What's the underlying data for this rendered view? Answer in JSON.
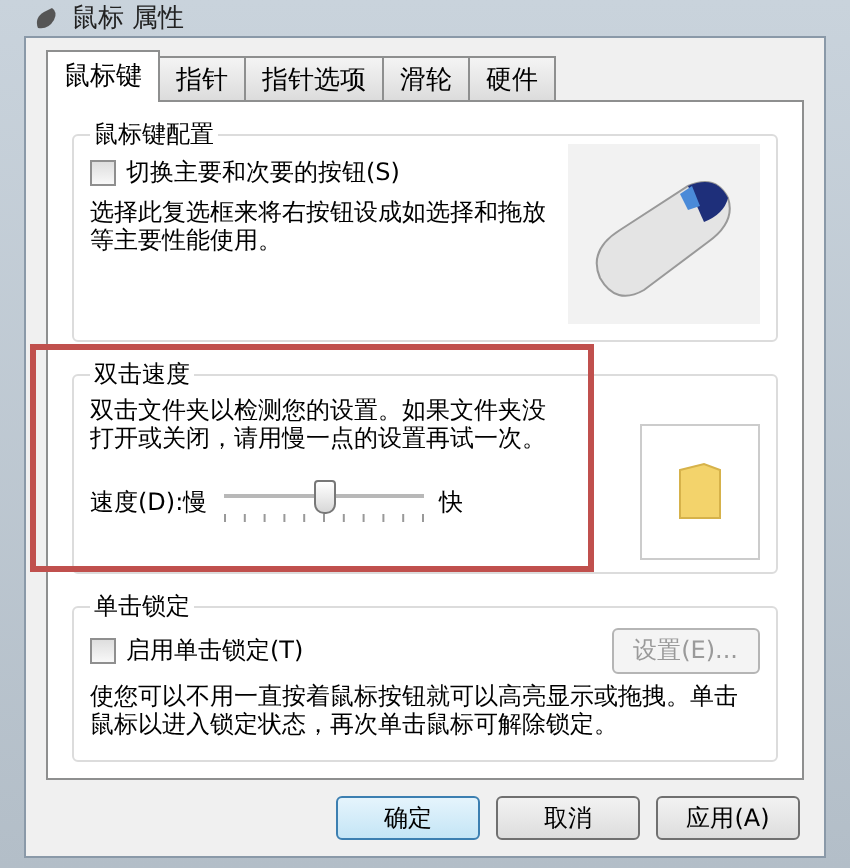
{
  "window": {
    "title": "鼠标 属性"
  },
  "tabs": [
    {
      "label": "鼠标键",
      "selected": true
    },
    {
      "label": "指针",
      "selected": false
    },
    {
      "label": "指针选项",
      "selected": false
    },
    {
      "label": "滑轮",
      "selected": false
    },
    {
      "label": "硬件",
      "selected": false
    }
  ],
  "button_config": {
    "title": "鼠标键配置",
    "checkbox": {
      "label": "切换主要和次要的按钮(S)",
      "checked": false
    },
    "description": "选择此复选框来将右按钮设成如选择和拖放等主要性能使用。"
  },
  "double_click": {
    "title": "双击速度",
    "description": "双击文件夹以检测您的设置。如果文件夹没打开或关闭，请用慢一点的设置再试一次。",
    "speed_label": "速度(D):慢",
    "fast_label": "快",
    "level": 0.5,
    "highlighted": true
  },
  "click_lock": {
    "title": "单击锁定",
    "checkbox": {
      "label": "启用单击锁定(T)",
      "checked": false
    },
    "settings_button": {
      "label": "设置(E)...",
      "disabled": true
    },
    "description": "使您可以不用一直按着鼠标按钮就可以高亮显示或拖拽。单击鼠标以进入锁定状态，再次单击鼠标可解除锁定。"
  },
  "buttons": [
    {
      "label": "确定",
      "kind": "default"
    },
    {
      "label": "取消",
      "kind": "normal"
    },
    {
      "label": "应用(A)",
      "kind": "normal"
    }
  ]
}
